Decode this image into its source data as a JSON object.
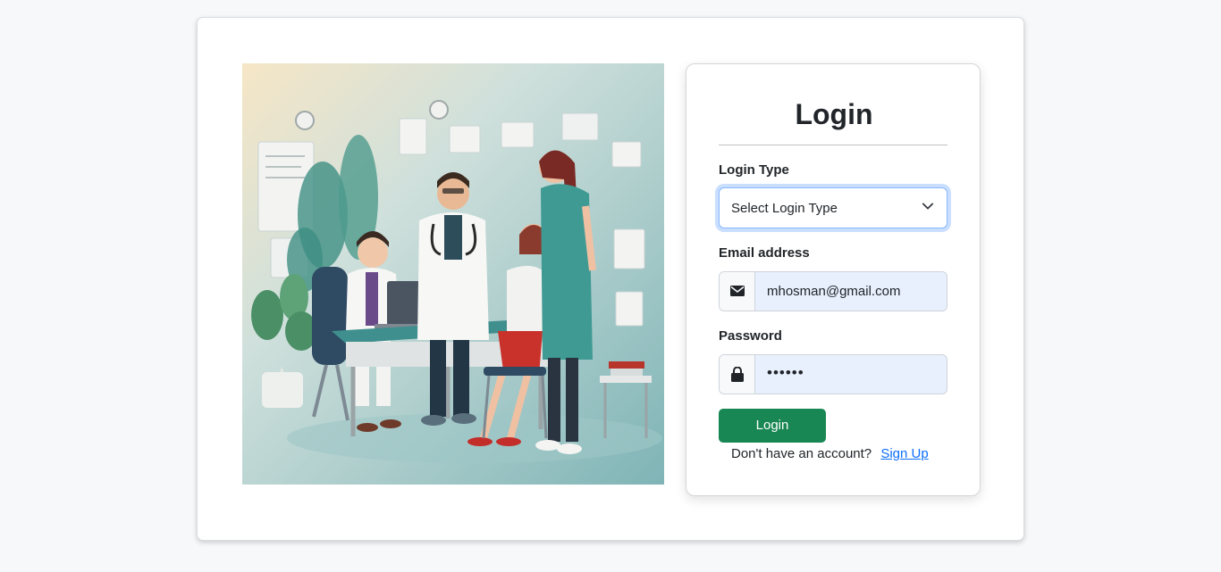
{
  "login": {
    "title": "Login",
    "login_type_label": "Login Type",
    "login_type_selected": "Select Login Type",
    "email_label": "Email address",
    "email_value": "mhosman@gmail.com",
    "password_label": "Password",
    "password_value": "••••••",
    "submit_label": "Login",
    "signup_prompt": "Don't have an account?",
    "signup_link": "Sign Up"
  },
  "icons": {
    "email": "envelope-icon",
    "password": "lock-icon",
    "select": "chevron-down-icon"
  },
  "colors": {
    "primary_button": "#198754",
    "link": "#0d6efd",
    "input_autofill": "#e8f0fe",
    "focus_ring": "#86b7fe"
  }
}
